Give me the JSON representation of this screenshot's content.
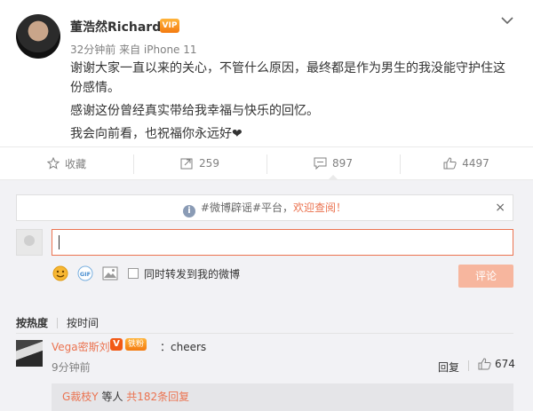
{
  "post": {
    "username": "董浩然Richard",
    "badge": "VIP",
    "time": "32分钟前",
    "source": "来自 iPhone 11",
    "lines": [
      "谢谢大家一直以来的关心，不管什么原因，最终都是作为男生的我没能守护住这份感情。",
      "感谢这份曾经真实带给我幸福与快乐的回忆。",
      "我会向前看，也祝福你永远好"
    ],
    "heart": "❤"
  },
  "actions": {
    "favorite": "收藏",
    "repost": "259",
    "comment": "897",
    "like": "4497"
  },
  "notice": {
    "prefix": "#微博辟谣#平台，",
    "link": "欢迎查阅！",
    "close": "×"
  },
  "composer": {
    "repost_label": "同时转发到我的微博",
    "submit": "评论"
  },
  "sort": {
    "hot": "按热度",
    "time": "按时间"
  },
  "comment": {
    "name": "Vega密斯刘",
    "v": "V",
    "fan": "铁粉",
    "text": "：cheers",
    "time": "9分钟前",
    "reply": "回复",
    "likes": "674"
  },
  "replies": {
    "name": "G裁枝Y",
    "mid": " 等人 ",
    "count": "共182条回复"
  },
  "colors": {
    "accent": "#eb7350",
    "submit_disabled": "#f7b69e",
    "panel_bg": "#f2f2f5"
  }
}
